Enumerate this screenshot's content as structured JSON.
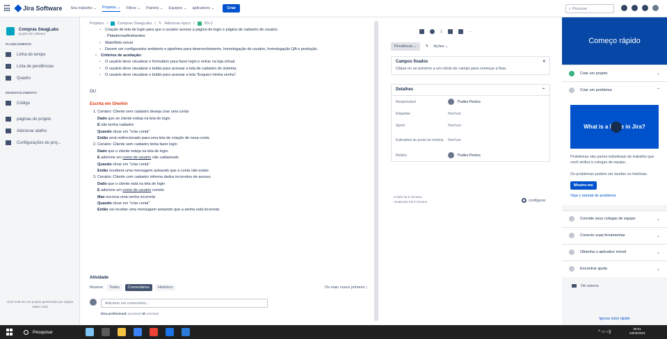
{
  "topnav": {
    "brand": "Jira Software",
    "menu": [
      {
        "label": "Seu trabalho ⌄",
        "active": false
      },
      {
        "label": "Projetos ⌄",
        "active": true
      },
      {
        "label": "Filtros ⌄",
        "active": false
      },
      {
        "label": "Painéis ⌄",
        "active": false
      },
      {
        "label": "Equipes ⌄",
        "active": false
      },
      {
        "label": "aplicativos ⌄",
        "active": false
      }
    ],
    "create_label": "Criar",
    "search_placeholder": "Procurar"
  },
  "sidebar": {
    "project_name": "Compras SwagLabs",
    "project_type": "projeto de software",
    "section_planning": "PLANEJAMENTO",
    "planning_items": [
      "Linha do tempo",
      "Lista de pendências",
      "Quadro"
    ],
    "section_dev": "DESENVOLVIMENTO",
    "dev_items": [
      "Código"
    ],
    "other_items": [
      "páginas do projeto",
      "Adicionar atalho",
      "Configurações do proj..."
    ],
    "footer_text": "Você está em um projeto gerenciado por equipe",
    "footer_link": "Saber mais"
  },
  "breadcrumb": {
    "root": "Projetos",
    "project": "Compras SwagLabs",
    "epic": "Adicionar épico",
    "issue": "SS-2"
  },
  "description": {
    "lines_top": [
      "Criação de tela de login para que o usuário acesse a página de login e página de cadastro do usuário.",
      ". Plataforma/Ambientes:",
      "Web/Web móvel",
      "Devem ser configurados ambiente e pipelines para desenvolvimento, homologação de usuário, homologação QA e produção."
    ],
    "criteria_title": "Critérios de aceitação:",
    "criteria": [
      "O usuário deve visualizar o formulário para fazer login e entrar na loja virtual.",
      "O usuário deve visualizar o botão para acessar a tela de cadastro do sistema.",
      "O usuário deve visualizar o botão para acessar a tela \"Esqueci minha senha\"."
    ],
    "ou": "OU",
    "gherkin_title": "Escrita em Gherkin"
  },
  "gherkin": {
    "s1_title": "1. Cenário: Cliente sem cadastro deseja criar uma conta",
    "s1_given_kw": "Dado",
    "s1_given": " que oo cliente esteja na tela de login",
    "s1_and_kw": "E",
    "s1_and": " não tenha cadastro",
    "s1_when_kw": "Quando",
    "s1_when": " clicar em \"criar conta\"",
    "s1_then_kw": "Então",
    "s1_then": " será redirecionado para uma tela de criação de nova conta.",
    "s2_title": "2. Cenário: Cliente sem cadastro tenta fazer login",
    "s2_given_kw": "Dado",
    "s2_given": " que o cliente esteja na tela de login",
    "s2_and_kw": "E",
    "s2_and_a": " adicione um ",
    "s2_and_u": "nome de usuário",
    "s2_and_b": " não cadastrado",
    "s2_when_kw": "Quando",
    "s2_when": " clicar em \"criar conta\"",
    "s2_then_kw": "Então",
    "s2_then": " receberá uma mensagem avisando que a conta não existe",
    "s3_title": "3. Cenário: Cliente com cadastro informa dados incorretos de acesso",
    "s3_given_kw": "Dado",
    "s3_given": " que o cliente está na tela de login",
    "s3_and_kw": "E",
    "s3_and_a": " adicione um ",
    "s3_and_u": "nome de usuário",
    "s3_and_b": " correto",
    "s3_but_kw": "Mas",
    "s3_but": " escreva uma senha incorreta",
    "s3_when_kw": "Quando",
    "s3_when": " clicar em \"criar conta\"",
    "s3_then_kw": "Então",
    "s3_then": " vai receber uma mensagem avisando que a senha está incorreta"
  },
  "activity": {
    "title": "Atividade",
    "show_label": "Mostrar:",
    "filters": [
      "Todos",
      "Comentários",
      "Histórico"
    ],
    "sort": "Os mais novos primeiro ↓",
    "comment_placeholder": "Adicione um comentário...",
    "tip_bold": "Dica profissional:",
    "tip_mid": " pressione ",
    "tip_key": "M",
    "tip_end": " comentar"
  },
  "details": {
    "watch_count": "1",
    "status_label": "Pendência ⌄",
    "actions_label": "Ações ⌄",
    "pinned_title": "Campos fixados",
    "pinned_body": "Clique no  ao próximo a um rótulo de campo para começar a fixar.",
    "details_title": "Detalhes",
    "fields": [
      {
        "label": "Responsável",
        "value": "Thalles Pereira",
        "avatar": true
      },
      {
        "label": "Etiquetas",
        "value": "Nenhum",
        "avatar": false
      },
      {
        "label": "Sprint",
        "value": "Nenhum",
        "avatar": false
      },
      {
        "label": "Estimativa de ponto de história",
        "value": "Nenhum",
        "avatar": false
      },
      {
        "label": "Relator",
        "value": "Thalles Pereira",
        "avatar": true
      }
    ],
    "created": "Criado há 5 minutos",
    "updated": "Atualizado há 5 minutos",
    "configure": "configurar"
  },
  "quickstart": {
    "title": "Começo rápido",
    "items": [
      {
        "label": "Criar um projeto",
        "done": true,
        "chev": "⌄"
      },
      {
        "label": "Criar um problema",
        "done": false,
        "chev": "⌃"
      }
    ],
    "video_text": "What is a Issue in Jira?",
    "text1": "Problemas são partes individuais do trabalho que você atribui a colegas de equipe.",
    "text2": "Os problemas podem ser tarefas ou histórias.",
    "show_btn": "Mostre-me",
    "tutorial": "Veja o tutorial do problema",
    "more_items": [
      "Convide seus colegas de equipe",
      "Conecte suas ferramentas",
      "Obtenha o aplicativo móvel",
      "Encontrar ajuda"
    ],
    "feedback": "Dê retorno",
    "ignore": "Ignorar início rápido"
  },
  "taskbar": {
    "search": "Pesquisar",
    "time": "08:01",
    "date": "04/03/2023"
  }
}
